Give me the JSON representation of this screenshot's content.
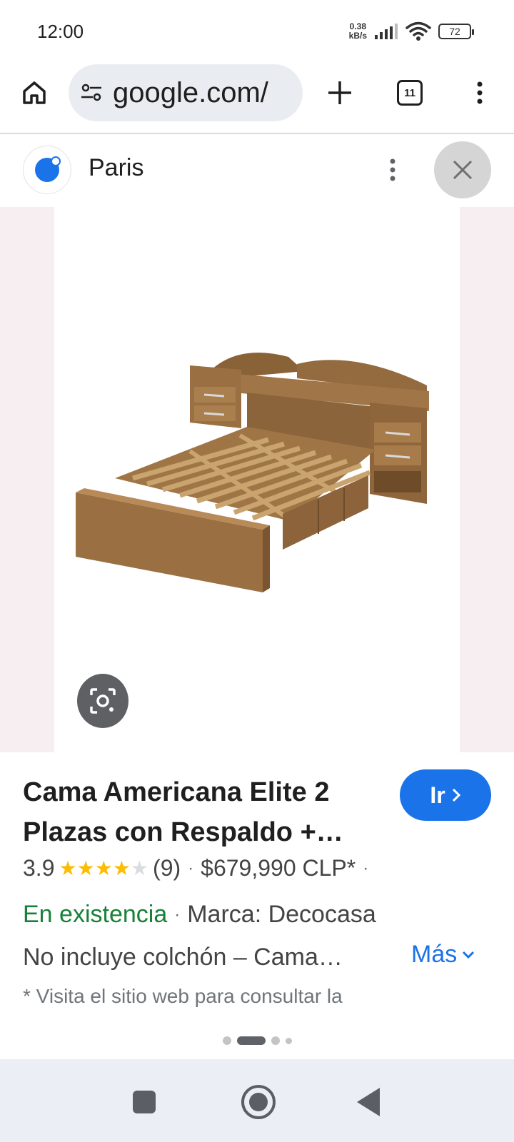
{
  "status_bar": {
    "time": "12:00",
    "net_speed_value": "0.38",
    "net_speed_unit": "kB/s",
    "battery": "72"
  },
  "browser": {
    "url": "google.com/",
    "tab_count": "11",
    "icons": {
      "home": "home-icon",
      "site_settings": "tune-icon",
      "new_tab": "plus-icon",
      "menu": "more-vert-icon"
    }
  },
  "merchant": {
    "name": "Paris",
    "logo_color": "#1a73e8"
  },
  "product": {
    "title": "Cama Americana Elite 2 Plazas con Respaldo +…",
    "go_button_label": "Ir",
    "rating": "3.9",
    "stars_filled": 4,
    "stars_total": 5,
    "reviews": "(9)",
    "price": "$679,990 CLP*",
    "availability": "En existencia",
    "brand": "Marca: Decocasa",
    "description": "No incluye colchón – Cama…",
    "more_label": "Más",
    "note": "* Visita el sitio web para consultar la"
  },
  "pager": {
    "count": 4,
    "active_index": 1
  },
  "colors": {
    "accent": "#1a73e8",
    "in_stock": "#188038",
    "star": "#fbbc04"
  }
}
